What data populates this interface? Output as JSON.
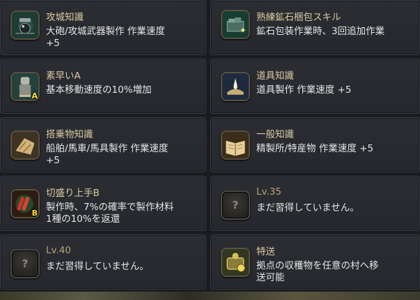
{
  "cards": [
    {
      "icon": "siege-weapon-icon",
      "title": "攻城知識",
      "desc": "大砲/攻城武器製作 作業速度\n+5",
      "tag": ""
    },
    {
      "icon": "ore-packing-icon",
      "title": "熟練鉱石梱包スキル",
      "desc": "鉱石包装作業時、3回追加作業",
      "tag": ""
    },
    {
      "icon": "agility-icon",
      "title": "素早いA",
      "desc": "基本移動速度の10%増加",
      "tag": "A"
    },
    {
      "icon": "tool-knowledge-icon",
      "title": "道具知識",
      "desc": "道具製作 作業速度 +5",
      "tag": ""
    },
    {
      "icon": "mount-knowledge-icon",
      "title": "搭乗物知識",
      "desc": "船舶/馬車/馬具製作 作業速度\n+5",
      "tag": ""
    },
    {
      "icon": "general-knowledge-icon",
      "title": "一般知識",
      "desc": "精製所/特産物 作業速度 +5",
      "tag": ""
    },
    {
      "icon": "resourceful-icon",
      "title": "切盛り上手B",
      "desc": "製作時、7%の確率で製作材料\n1種の10%を返還",
      "tag": "B"
    },
    {
      "icon": "locked-skill-icon",
      "title": "Lv.35",
      "desc": "まだ習得していません。",
      "tag": ""
    },
    {
      "icon": "locked-skill-icon",
      "title": "Lv.40",
      "desc": "まだ習得していません。",
      "tag": ""
    },
    {
      "icon": "special-delivery-icon",
      "title": "特送",
      "desc": "拠点の収穫物を任意の村へ移\n送可能",
      "tag": ""
    }
  ],
  "locked_glyph": "?",
  "colors": {
    "title": "#d9c9a0",
    "level": "#b9a278",
    "text": "#e6e6e6",
    "card": "#2a2c31"
  }
}
